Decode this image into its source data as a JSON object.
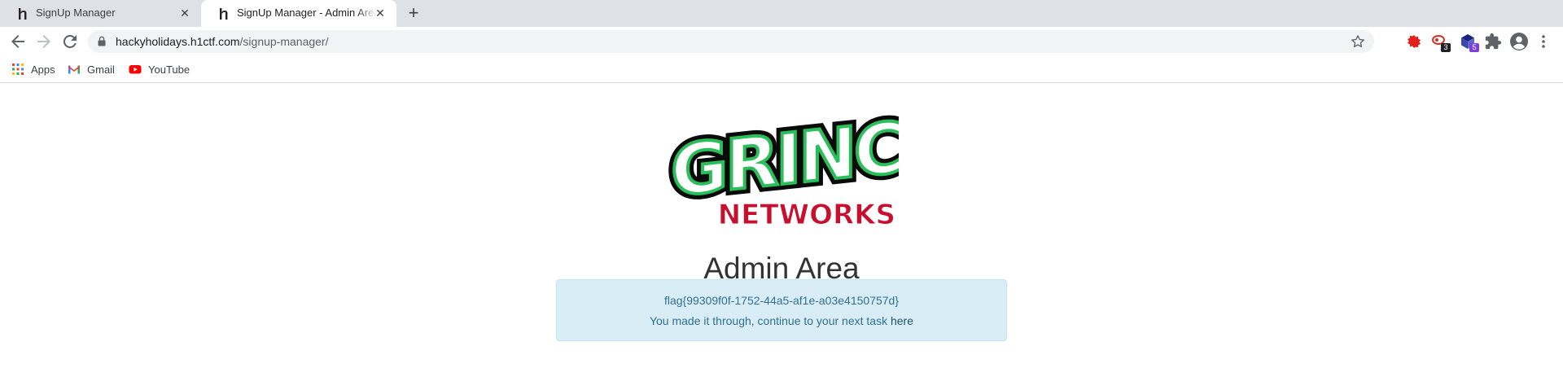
{
  "browser": {
    "tabs": [
      {
        "title": "SignUp Manager",
        "active": false
      },
      {
        "title": "SignUp Manager - Admin Area",
        "active": true
      }
    ],
    "address_bar": {
      "domain": "hackyholidays.h1ctf.com",
      "path": "/signup-manager/"
    },
    "extensions": [
      {
        "icon": "red-blob-extension-icon",
        "color": "#e0201c"
      },
      {
        "icon": "red-cloud-extension-icon",
        "badge": "3",
        "badge_color": "#202124"
      },
      {
        "icon": "purple-cube-extension-icon",
        "badge": "5",
        "badge_color": "#7b3fe4"
      },
      {
        "icon": "puzzle-extensions-icon"
      },
      {
        "icon": "profile-avatar-icon"
      },
      {
        "icon": "kebab-menu-icon"
      }
    ],
    "bookmarks": [
      {
        "label": "Apps",
        "icon": "apps-grid-icon"
      },
      {
        "label": "Gmail",
        "icon": "gmail-icon"
      },
      {
        "label": "YouTube",
        "icon": "youtube-icon"
      }
    ]
  },
  "page": {
    "logo_text": [
      "GRINCH",
      "NETWORKS"
    ],
    "title": "Admin Area",
    "alert": {
      "flag": "flag{99309f0f-1752-44a5-af1e-a03e4150757d}",
      "message": "You made it through, continue to your next task",
      "link_text": "here"
    },
    "colors": {
      "logo_green": "#2bbf5c",
      "logo_red": "#c8102e",
      "alert_bg": "#d9edf7",
      "alert_text": "#31708f"
    }
  }
}
